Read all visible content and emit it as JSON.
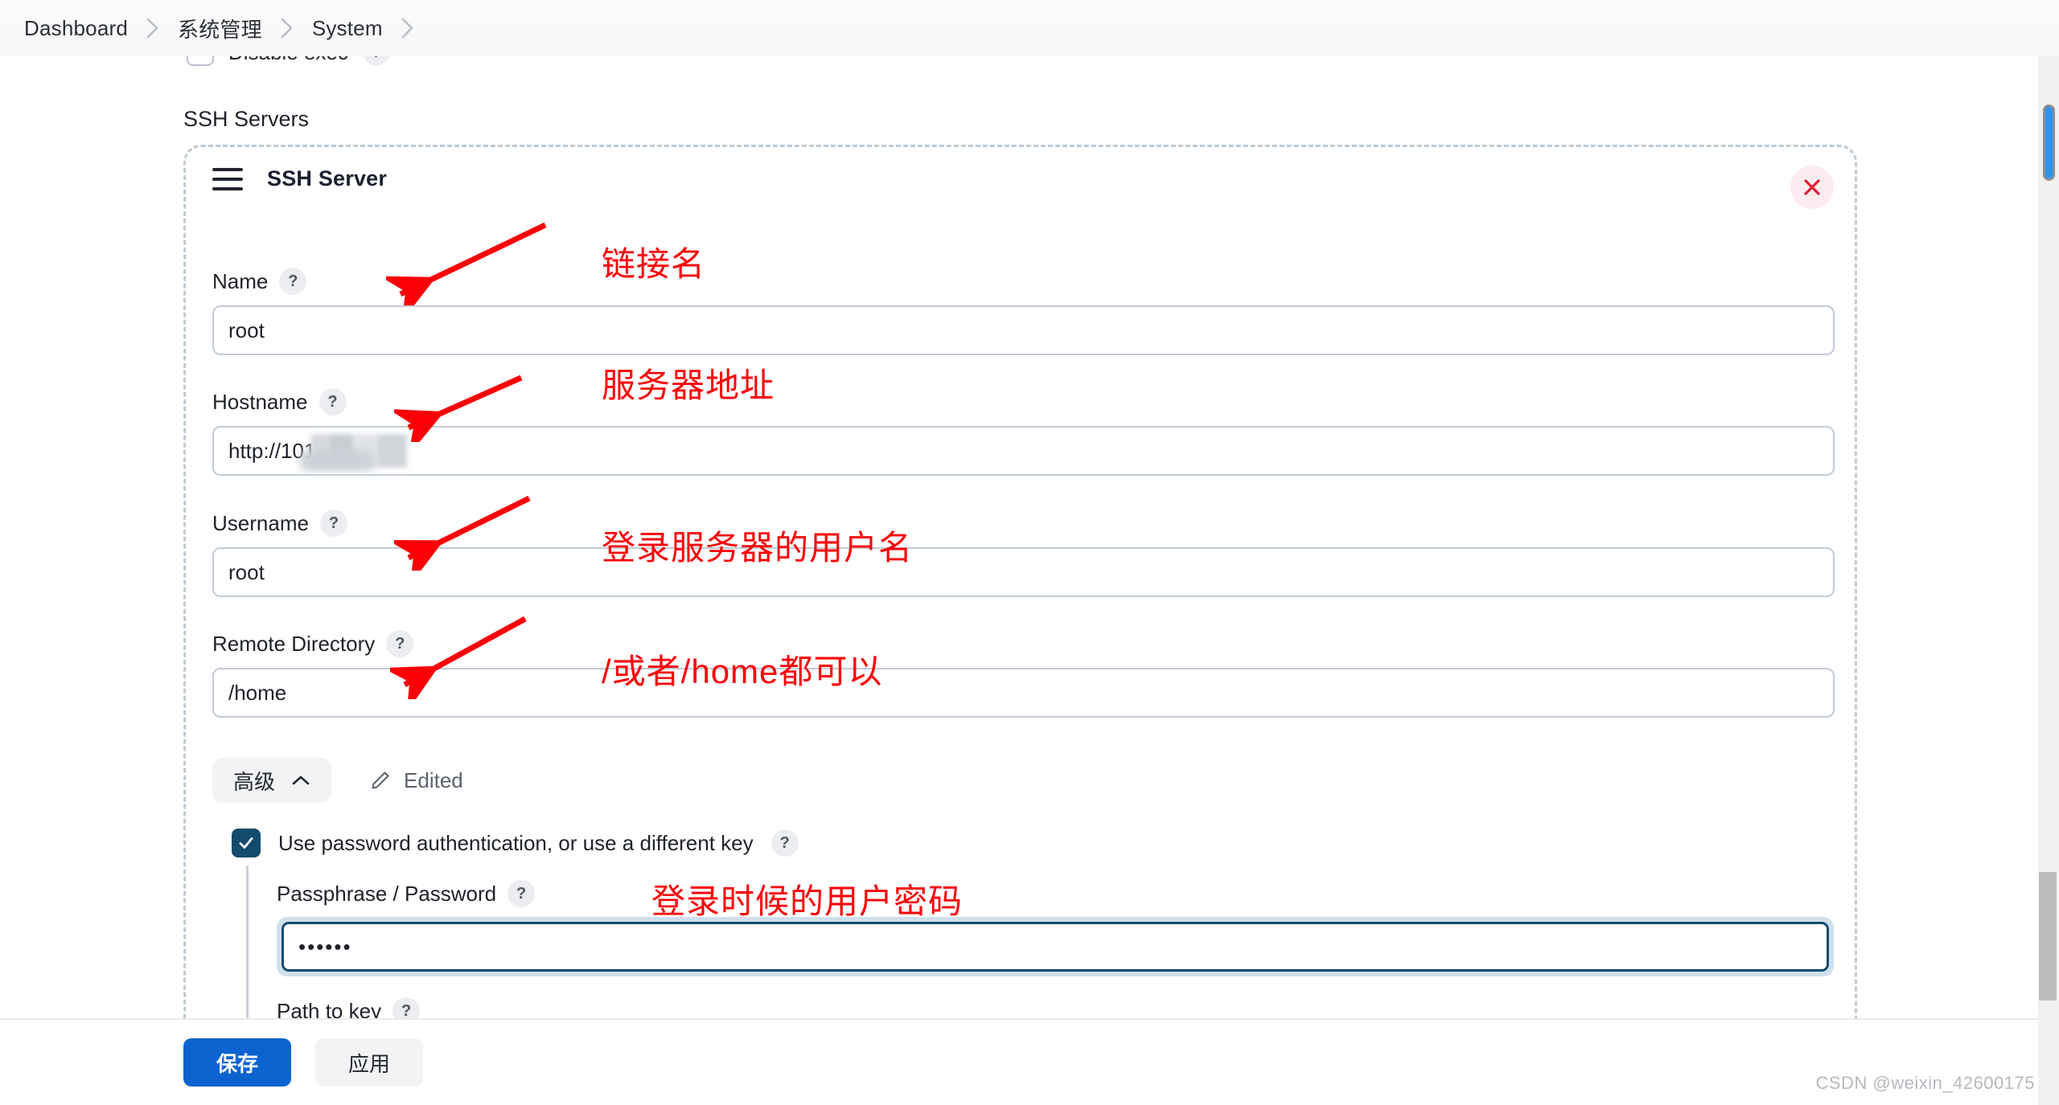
{
  "breadcrumb": {
    "items": [
      "Dashboard",
      "系统管理",
      "System"
    ],
    "separator_icon": "chevron-right-icon"
  },
  "clipped_top_row": {
    "label": "Disable exec",
    "help_badge": "?",
    "checked": false
  },
  "section": {
    "label": "SSH Servers"
  },
  "card": {
    "title": "SSH Server",
    "drag_handle_icon": "hamburger-drag-icon",
    "close_icon": "close-x-icon",
    "close_bg": "#fdecef",
    "close_color": "#e01e37",
    "fields": [
      {
        "label": "Name",
        "help": "?",
        "value": "root",
        "placeholder": ""
      },
      {
        "label": "Hostname",
        "help": "?",
        "value": "http://101",
        "placeholder": "",
        "redacted": true
      },
      {
        "label": "Username",
        "help": "?",
        "value": "root",
        "placeholder": ""
      },
      {
        "label": "Remote Directory",
        "help": "?",
        "value": "/home",
        "placeholder": ""
      }
    ],
    "advanced": {
      "toggle_label": "高级",
      "toggle_icon": "chevron-up-icon",
      "edited_label": "Edited",
      "edited_icon": "pencil-icon",
      "checkbox": {
        "label": "Use password authentication, or use a different key",
        "help": "?",
        "checked": true,
        "checked_color": "#134b6d"
      },
      "sub_fields": [
        {
          "label": "Passphrase / Password",
          "help": "?",
          "value": "••••••",
          "placeholder": "",
          "focused": true
        },
        {
          "label": "Path to key",
          "help": "?",
          "value": "",
          "placeholder": "",
          "focused": false
        }
      ]
    }
  },
  "annotations": {
    "color": "#fb0007",
    "items": [
      {
        "text": "链接名"
      },
      {
        "text": "服务器地址"
      },
      {
        "text": "登录服务器的用户名"
      },
      {
        "text": "/或者/home都可以"
      },
      {
        "text": "登录时候的用户密码"
      }
    ]
  },
  "footer": {
    "save_label": "保存",
    "save_color": "#0a63cf",
    "apply_label": "应用"
  },
  "watermark": {
    "text": "CSDN @weixin_42600175"
  }
}
